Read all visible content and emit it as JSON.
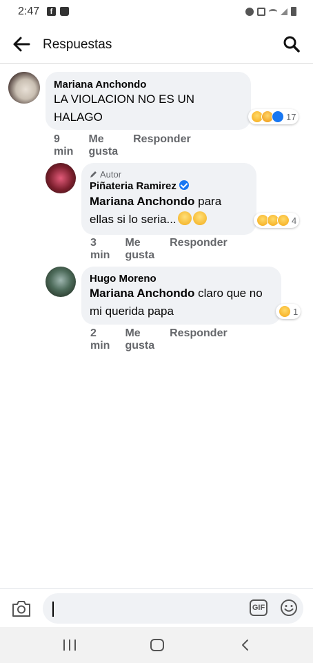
{
  "status_bar": {
    "time": "2:47",
    "left_icons": [
      "facebook-icon",
      "shopping-bag-icon"
    ],
    "right_icons": [
      "alarm-icon",
      "mute-icon",
      "wifi-icon",
      "signal-icon",
      "battery-icon"
    ]
  },
  "header": {
    "title": "Respuestas",
    "back_icon": "arrow-left-icon",
    "search_icon": "search-icon"
  },
  "comments": [
    {
      "author": "Mariana Anchondo",
      "text": "LA VIOLACION NO ES UN HALAGO",
      "time": "9 min",
      "like_label": "Me gusta",
      "reply_label": "Responder",
      "reactions": [
        "haha",
        "care",
        "like"
      ],
      "reaction_count": "17"
    },
    {
      "badge": "Autor",
      "author": "Piñateria Ramirez",
      "verified": true,
      "mention": "Mariana Anchondo",
      "text": "para ellas si lo seria...",
      "text_emojis": [
        "rolling-eyes-emoji",
        "thinking-emoji"
      ],
      "time": "3 min",
      "like_label": "Me gusta",
      "reply_label": "Responder",
      "reactions": [
        "haha",
        "wow",
        "sad"
      ],
      "reaction_count": "4"
    },
    {
      "author": "Hugo Moreno",
      "mention": "Mariana Anchondo",
      "text": "claro que no mi querida papa",
      "time": "2 min",
      "like_label": "Me gusta",
      "reply_label": "Responder",
      "reactions": [
        "haha"
      ],
      "reaction_count": "1"
    }
  ],
  "composer": {
    "value": "",
    "camera_icon": "camera-icon",
    "gif_label": "GIF",
    "emoji_icon": "smiley-icon"
  },
  "navbar": {
    "icons": [
      "recents-icon",
      "home-icon",
      "back-icon"
    ]
  },
  "colors": {
    "bubble": "#f0f2f5",
    "meta_text": "#65676b",
    "verified": "#1877f2",
    "like": "#1877f2"
  }
}
